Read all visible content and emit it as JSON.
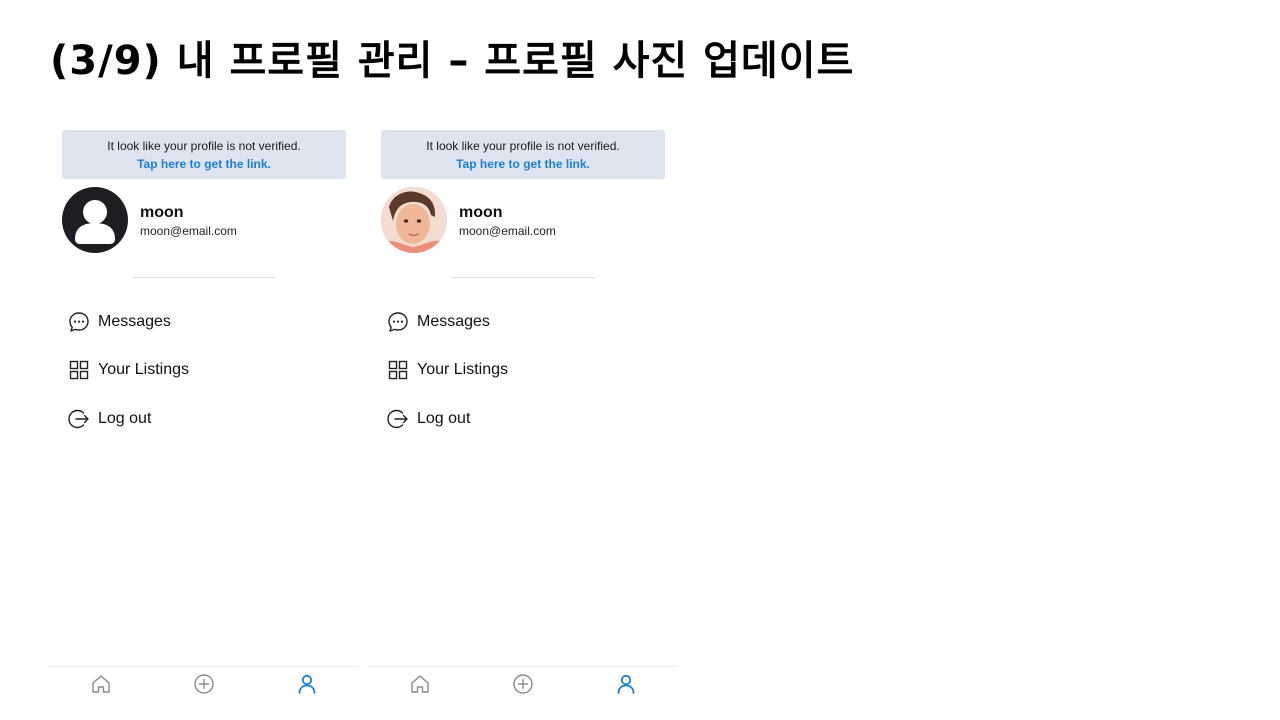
{
  "slide": {
    "title": "(3/9) 내 프로필 관리 – 프로필 사진 업데이트"
  },
  "colors": {
    "banner_bg": "#dde4f0",
    "link": "#1f7fd1",
    "active_tab": "#1f7fd1",
    "inactive_tab": "#8a8a8a"
  },
  "screens": [
    {
      "banner": {
        "message": "It look like your profile is not verified.",
        "link": "Tap here to get the link."
      },
      "avatar": "default-user-icon",
      "user": {
        "name": "moon",
        "email": "moon@email.com"
      },
      "menu": [
        {
          "label": "Messages",
          "icon": "chat-bubble-icon"
        },
        {
          "label": "Your Listings",
          "icon": "grid-icon"
        },
        {
          "label": "Log out",
          "icon": "logout-icon"
        }
      ],
      "tabbar": {
        "active": "profile",
        "tabs": [
          "home-icon",
          "add-circle-icon",
          "profile-icon"
        ]
      }
    },
    {
      "banner": {
        "message": "It look like your profile is not verified.",
        "link": "Tap here to get the link."
      },
      "avatar": "profile-photo",
      "user": {
        "name": "moon",
        "email": "moon@email.com"
      },
      "menu": [
        {
          "label": "Messages",
          "icon": "chat-bubble-icon"
        },
        {
          "label": "Your Listings",
          "icon": "grid-icon"
        },
        {
          "label": "Log out",
          "icon": "logout-icon"
        }
      ],
      "tabbar": {
        "active": "profile",
        "tabs": [
          "home-icon",
          "add-circle-icon",
          "profile-icon"
        ]
      }
    }
  ]
}
